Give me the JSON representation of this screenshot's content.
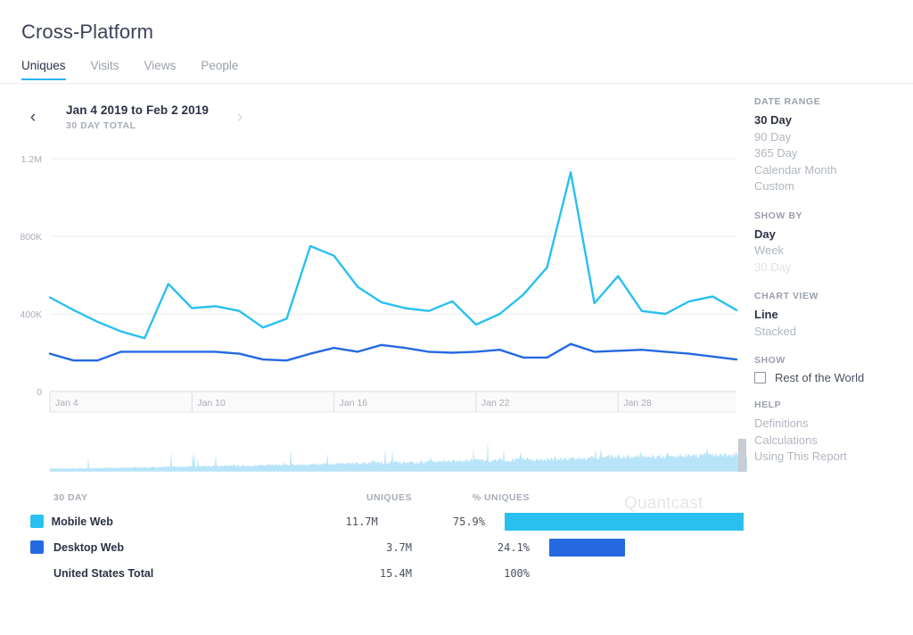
{
  "header": {
    "title": "Cross-Platform",
    "tabs": [
      {
        "label": "Uniques",
        "active": true
      },
      {
        "label": "Visits",
        "active": false
      },
      {
        "label": "Views",
        "active": false
      },
      {
        "label": "People",
        "active": false
      }
    ]
  },
  "date_nav": {
    "prev_icon": "chevron-left-icon",
    "next_icon": "chevron-right-icon",
    "range": "Jan 4 2019 to Feb 2 2019",
    "subtitle": "30 DAY TOTAL"
  },
  "watermark": "Quantcast",
  "colors": {
    "mobile_web": "#29c0f0",
    "desktop_web": "#2569e0",
    "accent": "#29b6f0",
    "minimap_fill": "#b7e4f8",
    "gridline": "#ececec",
    "axis_text": "#a7adb8"
  },
  "table": {
    "columns": [
      "30 DAY",
      "UNIQUES",
      "% UNIQUES"
    ],
    "rows": [
      {
        "swatch": "#29c0f0",
        "name": "Mobile Web",
        "uniques": "11.7M",
        "pct": "75.9%",
        "bar_pct": 75.9,
        "bar_color": "#29c0f0"
      },
      {
        "swatch": "#2569e0",
        "name": "Desktop Web",
        "uniques": "3.7M",
        "pct": "24.1%",
        "bar_pct": 24.1,
        "bar_color": "#2569e0"
      },
      {
        "swatch": null,
        "name": "United States Total",
        "uniques": "15.4M",
        "pct": "100%",
        "bar_pct": 0,
        "bar_color": null
      }
    ]
  },
  "sidebar": {
    "groups": [
      {
        "heading": "DATE RANGE",
        "items": [
          {
            "label": "30 Day",
            "state": "selected"
          },
          {
            "label": "90 Day",
            "state": "normal"
          },
          {
            "label": "365 Day",
            "state": "normal"
          },
          {
            "label": "Calendar Month",
            "state": "normal"
          },
          {
            "label": "Custom",
            "state": "normal"
          }
        ]
      },
      {
        "heading": "SHOW BY",
        "items": [
          {
            "label": "Day",
            "state": "selected"
          },
          {
            "label": "Week",
            "state": "normal"
          },
          {
            "label": "30 Day",
            "state": "disabled"
          }
        ]
      },
      {
        "heading": "CHART VIEW",
        "items": [
          {
            "label": "Line",
            "state": "selected"
          },
          {
            "label": "Stacked",
            "state": "normal"
          }
        ]
      },
      {
        "heading": "SHOW",
        "checkbox": {
          "label": "Rest of the World",
          "checked": false
        }
      },
      {
        "heading": "HELP",
        "items": [
          {
            "label": "Definitions",
            "state": "help"
          },
          {
            "label": "Calculations",
            "state": "help"
          },
          {
            "label": "Using This Report",
            "state": "help"
          }
        ]
      }
    ]
  },
  "chart_data": {
    "type": "line",
    "title": "",
    "xlabel": "",
    "ylabel": "",
    "ylim": [
      0,
      1200000
    ],
    "ytick_labels": [
      "0",
      "400K",
      "800K",
      "1.2M"
    ],
    "ytick_values": [
      0,
      400000,
      800000,
      1200000
    ],
    "xtick_labels": [
      "Jan 4",
      "Jan 10",
      "Jan 16",
      "Jan 22",
      "Jan 28"
    ],
    "xtick_indices": [
      0,
      6,
      12,
      18,
      24
    ],
    "grid": true,
    "legend_position": "below-table",
    "x": [
      "Jan 4",
      "Jan 5",
      "Jan 6",
      "Jan 7",
      "Jan 8",
      "Jan 9",
      "Jan 10",
      "Jan 11",
      "Jan 12",
      "Jan 13",
      "Jan 14",
      "Jan 15",
      "Jan 16",
      "Jan 17",
      "Jan 18",
      "Jan 19",
      "Jan 20",
      "Jan 21",
      "Jan 22",
      "Jan 23",
      "Jan 24",
      "Jan 25",
      "Jan 26",
      "Jan 27",
      "Jan 28",
      "Jan 29",
      "Jan 30",
      "Jan 31",
      "Feb 1",
      "Feb 2"
    ],
    "series": [
      {
        "name": "Mobile Web",
        "color": "#29c0f0",
        "values": [
          485000,
          420000,
          360000,
          310000,
          275000,
          555000,
          430000,
          440000,
          415000,
          330000,
          375000,
          750000,
          700000,
          540000,
          460000,
          430000,
          415000,
          465000,
          345000,
          400000,
          500000,
          640000,
          1130000,
          455000,
          595000,
          415000,
          400000,
          465000,
          490000,
          420000
        ]
      },
      {
        "name": "Desktop Web",
        "color": "#2569e0",
        "values": [
          195000,
          160000,
          160000,
          205000,
          205000,
          205000,
          205000,
          205000,
          195000,
          165000,
          160000,
          195000,
          225000,
          205000,
          240000,
          225000,
          205000,
          200000,
          205000,
          215000,
          175000,
          175000,
          245000,
          205000,
          210000,
          215000,
          205000,
          195000,
          180000,
          165000
        ]
      }
    ]
  }
}
